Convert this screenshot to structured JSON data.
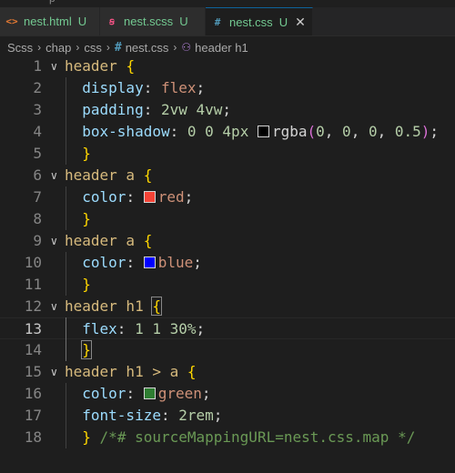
{
  "window": {
    "top_peek": "p"
  },
  "tabs": [
    {
      "icon": "<>",
      "name": "nest.html",
      "status": "U",
      "color": "#e37933",
      "active": false
    },
    {
      "icon": "ꞩ",
      "name": "nest.scss",
      "status": "U",
      "color": "#f55385",
      "active": false
    },
    {
      "icon": "#",
      "name": "nest.css",
      "status": "U",
      "color": "#519aba",
      "active": true,
      "close": "✕"
    }
  ],
  "breadcrumb": [
    "Scss",
    "chap",
    "css",
    "nest.css",
    "header h1"
  ],
  "swatches": {
    "black": "#000000",
    "red": "#f44336",
    "blue": "#0000ff",
    "green": "#2e7d32"
  },
  "code": {
    "current_line": 13,
    "lines": [
      {
        "n": "1",
        "tokens": [
          [
            "sel",
            "header"
          ],
          [
            "punc",
            " "
          ],
          [
            "br1",
            "{"
          ]
        ],
        "fold": "∨"
      },
      {
        "n": "2",
        "tokens": [
          [
            "prop",
            "  display"
          ],
          [
            "punc",
            ": "
          ],
          [
            "val",
            "flex"
          ],
          [
            "punc",
            ";"
          ]
        ]
      },
      {
        "n": "3",
        "tokens": [
          [
            "prop",
            "  padding"
          ],
          [
            "punc",
            ": "
          ],
          [
            "num",
            "2vw"
          ],
          [
            "punc",
            " "
          ],
          [
            "num",
            "4vw"
          ],
          [
            "punc",
            ";"
          ]
        ]
      },
      {
        "n": "4",
        "tokens": [
          [
            "prop",
            "  box-shadow"
          ],
          [
            "punc",
            ": "
          ],
          [
            "num",
            "0"
          ],
          [
            "punc",
            " "
          ],
          [
            "num",
            "0"
          ],
          [
            "punc",
            " "
          ],
          [
            "num",
            "4px"
          ],
          [
            "punc",
            " "
          ],
          [
            "swatch",
            "black"
          ],
          [
            "punc",
            "rgba"
          ],
          [
            "br2",
            "("
          ],
          [
            "num",
            "0"
          ],
          [
            "punc",
            ", "
          ],
          [
            "num",
            "0"
          ],
          [
            "punc",
            ", "
          ],
          [
            "num",
            "0"
          ],
          [
            "punc",
            ", "
          ],
          [
            "num",
            "0.5"
          ],
          [
            "br2",
            ")"
          ],
          [
            "punc",
            ";"
          ]
        ]
      },
      {
        "n": "5",
        "tokens": [
          [
            "punc",
            "  "
          ],
          [
            "br1",
            "}"
          ]
        ]
      },
      {
        "n": "6",
        "tokens": [
          [
            "sel",
            "header a"
          ],
          [
            "punc",
            " "
          ],
          [
            "br1",
            "{"
          ]
        ],
        "fold": "∨"
      },
      {
        "n": "7",
        "tokens": [
          [
            "prop",
            "  color"
          ],
          [
            "punc",
            ": "
          ],
          [
            "swatch",
            "red"
          ],
          [
            "val",
            "red"
          ],
          [
            "punc",
            ";"
          ]
        ]
      },
      {
        "n": "8",
        "tokens": [
          [
            "punc",
            "  "
          ],
          [
            "br1",
            "}"
          ]
        ]
      },
      {
        "n": "9",
        "tokens": [
          [
            "sel",
            "header a"
          ],
          [
            "punc",
            " "
          ],
          [
            "br1",
            "{"
          ]
        ],
        "fold": "∨"
      },
      {
        "n": "10",
        "tokens": [
          [
            "prop",
            "  color"
          ],
          [
            "punc",
            ": "
          ],
          [
            "swatch",
            "blue"
          ],
          [
            "val",
            "blue"
          ],
          [
            "punc",
            ";"
          ]
        ]
      },
      {
        "n": "11",
        "tokens": [
          [
            "punc",
            "  "
          ],
          [
            "br1",
            "}"
          ]
        ]
      },
      {
        "n": "12",
        "tokens": [
          [
            "sel",
            "header h1"
          ],
          [
            "punc",
            " "
          ],
          [
            "br1hl",
            "{"
          ]
        ],
        "fold": "∨"
      },
      {
        "n": "13",
        "tokens": [
          [
            "prop",
            "  flex"
          ],
          [
            "punc",
            ": "
          ],
          [
            "num",
            "1"
          ],
          [
            "punc",
            " "
          ],
          [
            "num",
            "1"
          ],
          [
            "punc",
            " "
          ],
          [
            "num",
            "30%"
          ],
          [
            "punc",
            ";"
          ]
        ]
      },
      {
        "n": "14",
        "tokens": [
          [
            "punc",
            "  "
          ],
          [
            "br1hl",
            "}"
          ]
        ]
      },
      {
        "n": "15",
        "tokens": [
          [
            "sel",
            "header h1 > a"
          ],
          [
            "punc",
            " "
          ],
          [
            "br1",
            "{"
          ]
        ],
        "fold": "∨"
      },
      {
        "n": "16",
        "tokens": [
          [
            "prop",
            "  color"
          ],
          [
            "punc",
            ": "
          ],
          [
            "swatch",
            "green"
          ],
          [
            "val",
            "green"
          ],
          [
            "punc",
            ";"
          ]
        ]
      },
      {
        "n": "17",
        "tokens": [
          [
            "prop",
            "  font-size"
          ],
          [
            "punc",
            ": "
          ],
          [
            "num",
            "2rem"
          ],
          [
            "punc",
            ";"
          ]
        ]
      },
      {
        "n": "18",
        "tokens": [
          [
            "punc",
            "  "
          ],
          [
            "br1",
            "}"
          ],
          [
            "punc",
            " "
          ],
          [
            "com",
            "/*# sourceMappingURL=nest.css.map */"
          ]
        ]
      }
    ]
  }
}
